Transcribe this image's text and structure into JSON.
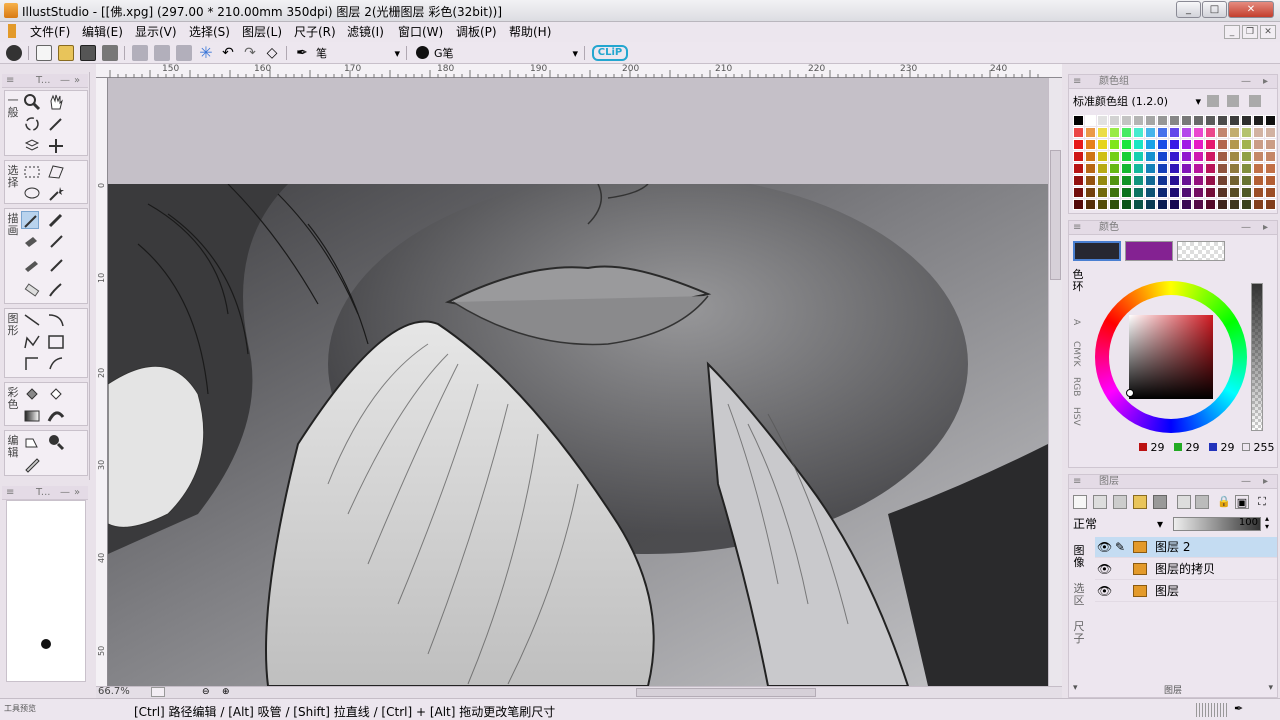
{
  "window": {
    "title": "IllustStudio - [[佛.xpg] (297.00 * 210.00mm 350dpi)   图层 2(光栅图层 彩色(32bit))]",
    "btn_min": "_",
    "btn_max": "□",
    "btn_close": "✕"
  },
  "menu": {
    "items": [
      "文件(F)",
      "编辑(E)",
      "显示(V)",
      "选择(S)",
      "图层(L)",
      "尺子(R)",
      "滤镜(I)",
      "窗口(W)",
      "调板(P)",
      "帮助(H)"
    ]
  },
  "toolbar": {
    "tool_name": "笔",
    "brush_name": "G笔",
    "logo": "CLiP"
  },
  "left_panel": {
    "title": "T...",
    "groups": [
      "一般",
      "选择",
      "描画",
      "图形",
      "彩色",
      "编辑"
    ],
    "lower_title": "T...",
    "bottom_label": "工具预览",
    "zoom": "66.7%"
  },
  "ruler": {
    "top": [
      "150",
      "160",
      "170",
      "180",
      "190",
      "200",
      "210",
      "220",
      "230",
      "240"
    ],
    "left": [
      "0",
      "10",
      "20",
      "30",
      "40",
      "50"
    ]
  },
  "color_set_panel": {
    "title": "颜色组",
    "preset": "标准颜色组 (1.2.0)"
  },
  "color_panel": {
    "title": "颜色",
    "main_color": "#272731",
    "sub_color": "#842292",
    "tabs": [
      "色环",
      "A",
      "CMYK",
      "RGB",
      "HSV"
    ],
    "r": "29",
    "g": "29",
    "b": "29",
    "alpha": "255"
  },
  "layers_panel": {
    "title": "图层",
    "blend_mode": "正常",
    "opacity": "100",
    "side_tabs": [
      "图像",
      "选区",
      "尺子"
    ],
    "layers": [
      {
        "name": "图层 2",
        "selected": true,
        "editing": true
      },
      {
        "name": "图层的拷贝",
        "selected": false,
        "editing": false
      },
      {
        "name": "图层",
        "selected": false,
        "editing": false
      }
    ],
    "bottom_label": "图层"
  },
  "status": {
    "hint": "[Ctrl] 路径编辑 / [Alt] 吸管 / [Shift] 拉直线 / [Ctrl] + [Alt] 拖动更改笔刷尺寸"
  }
}
